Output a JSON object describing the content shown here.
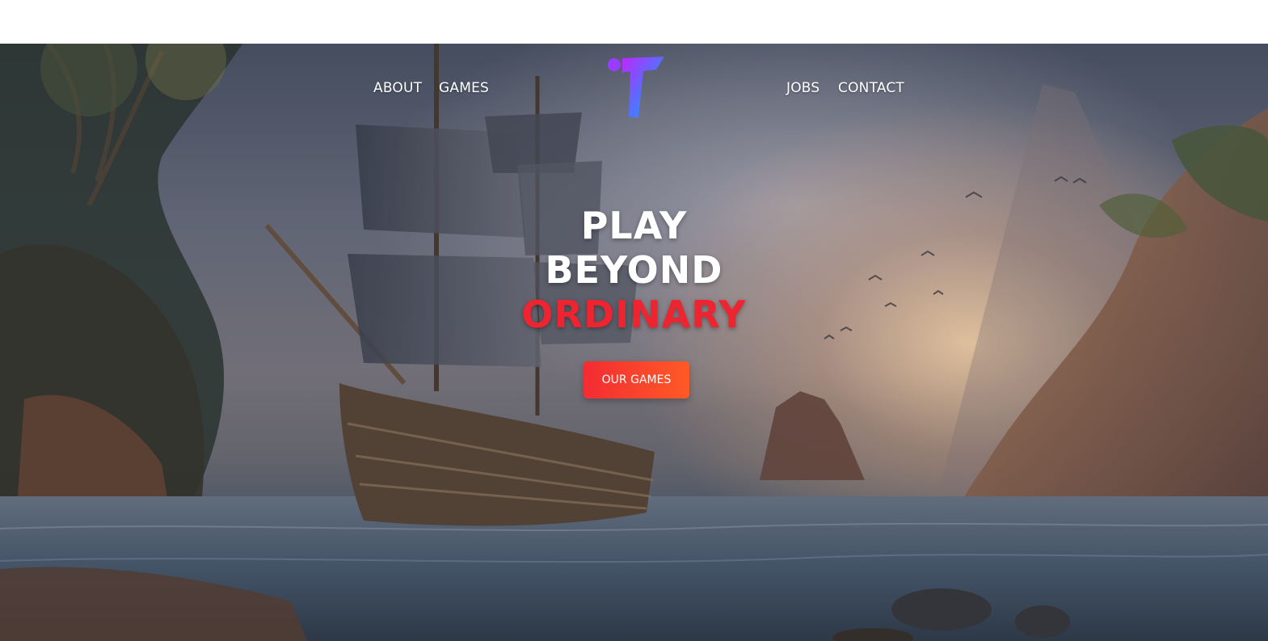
{
  "nav": {
    "left": [
      {
        "label": "ABOUT"
      },
      {
        "label": "GAMES"
      }
    ],
    "right": [
      {
        "label": "JOBS"
      },
      {
        "label": "CONTACT"
      }
    ]
  },
  "logo": {
    "icon": "brand-t-logo-icon",
    "colors": [
      "#c026ff",
      "#5b6bff",
      "#1ea0ff"
    ]
  },
  "hero": {
    "headline": [
      "PLAY",
      "BEYOND",
      "ORDINARY"
    ],
    "accent_color": "#ee2430",
    "cta_label": "OUR GAMES",
    "background": "pirate-ship-cove-image"
  }
}
